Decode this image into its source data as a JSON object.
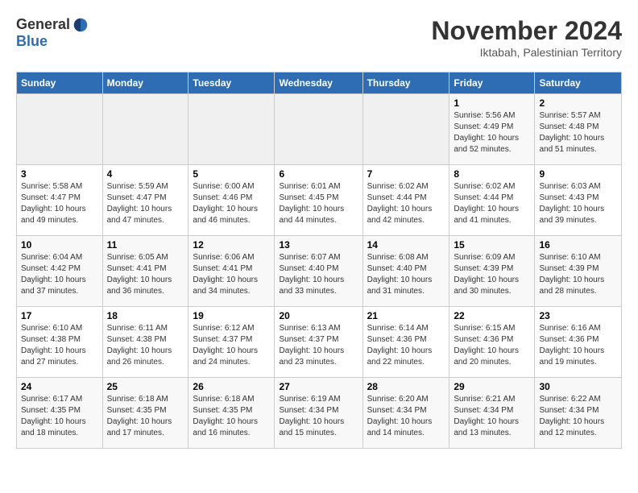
{
  "header": {
    "logo_general": "General",
    "logo_blue": "Blue",
    "month_title": "November 2024",
    "subtitle": "Iktabah, Palestinian Territory"
  },
  "days_of_week": [
    "Sunday",
    "Monday",
    "Tuesday",
    "Wednesday",
    "Thursday",
    "Friday",
    "Saturday"
  ],
  "weeks": [
    {
      "days": [
        {
          "num": "",
          "info": ""
        },
        {
          "num": "",
          "info": ""
        },
        {
          "num": "",
          "info": ""
        },
        {
          "num": "",
          "info": ""
        },
        {
          "num": "",
          "info": ""
        },
        {
          "num": "1",
          "info": "Sunrise: 5:56 AM\nSunset: 4:49 PM\nDaylight: 10 hours\nand 52 minutes."
        },
        {
          "num": "2",
          "info": "Sunrise: 5:57 AM\nSunset: 4:48 PM\nDaylight: 10 hours\nand 51 minutes."
        }
      ]
    },
    {
      "days": [
        {
          "num": "3",
          "info": "Sunrise: 5:58 AM\nSunset: 4:47 PM\nDaylight: 10 hours\nand 49 minutes."
        },
        {
          "num": "4",
          "info": "Sunrise: 5:59 AM\nSunset: 4:47 PM\nDaylight: 10 hours\nand 47 minutes."
        },
        {
          "num": "5",
          "info": "Sunrise: 6:00 AM\nSunset: 4:46 PM\nDaylight: 10 hours\nand 46 minutes."
        },
        {
          "num": "6",
          "info": "Sunrise: 6:01 AM\nSunset: 4:45 PM\nDaylight: 10 hours\nand 44 minutes."
        },
        {
          "num": "7",
          "info": "Sunrise: 6:02 AM\nSunset: 4:44 PM\nDaylight: 10 hours\nand 42 minutes."
        },
        {
          "num": "8",
          "info": "Sunrise: 6:02 AM\nSunset: 4:44 PM\nDaylight: 10 hours\nand 41 minutes."
        },
        {
          "num": "9",
          "info": "Sunrise: 6:03 AM\nSunset: 4:43 PM\nDaylight: 10 hours\nand 39 minutes."
        }
      ]
    },
    {
      "days": [
        {
          "num": "10",
          "info": "Sunrise: 6:04 AM\nSunset: 4:42 PM\nDaylight: 10 hours\nand 37 minutes."
        },
        {
          "num": "11",
          "info": "Sunrise: 6:05 AM\nSunset: 4:41 PM\nDaylight: 10 hours\nand 36 minutes."
        },
        {
          "num": "12",
          "info": "Sunrise: 6:06 AM\nSunset: 4:41 PM\nDaylight: 10 hours\nand 34 minutes."
        },
        {
          "num": "13",
          "info": "Sunrise: 6:07 AM\nSunset: 4:40 PM\nDaylight: 10 hours\nand 33 minutes."
        },
        {
          "num": "14",
          "info": "Sunrise: 6:08 AM\nSunset: 4:40 PM\nDaylight: 10 hours\nand 31 minutes."
        },
        {
          "num": "15",
          "info": "Sunrise: 6:09 AM\nSunset: 4:39 PM\nDaylight: 10 hours\nand 30 minutes."
        },
        {
          "num": "16",
          "info": "Sunrise: 6:10 AM\nSunset: 4:39 PM\nDaylight: 10 hours\nand 28 minutes."
        }
      ]
    },
    {
      "days": [
        {
          "num": "17",
          "info": "Sunrise: 6:10 AM\nSunset: 4:38 PM\nDaylight: 10 hours\nand 27 minutes."
        },
        {
          "num": "18",
          "info": "Sunrise: 6:11 AM\nSunset: 4:38 PM\nDaylight: 10 hours\nand 26 minutes."
        },
        {
          "num": "19",
          "info": "Sunrise: 6:12 AM\nSunset: 4:37 PM\nDaylight: 10 hours\nand 24 minutes."
        },
        {
          "num": "20",
          "info": "Sunrise: 6:13 AM\nSunset: 4:37 PM\nDaylight: 10 hours\nand 23 minutes."
        },
        {
          "num": "21",
          "info": "Sunrise: 6:14 AM\nSunset: 4:36 PM\nDaylight: 10 hours\nand 22 minutes."
        },
        {
          "num": "22",
          "info": "Sunrise: 6:15 AM\nSunset: 4:36 PM\nDaylight: 10 hours\nand 20 minutes."
        },
        {
          "num": "23",
          "info": "Sunrise: 6:16 AM\nSunset: 4:36 PM\nDaylight: 10 hours\nand 19 minutes."
        }
      ]
    },
    {
      "days": [
        {
          "num": "24",
          "info": "Sunrise: 6:17 AM\nSunset: 4:35 PM\nDaylight: 10 hours\nand 18 minutes."
        },
        {
          "num": "25",
          "info": "Sunrise: 6:18 AM\nSunset: 4:35 PM\nDaylight: 10 hours\nand 17 minutes."
        },
        {
          "num": "26",
          "info": "Sunrise: 6:18 AM\nSunset: 4:35 PM\nDaylight: 10 hours\nand 16 minutes."
        },
        {
          "num": "27",
          "info": "Sunrise: 6:19 AM\nSunset: 4:34 PM\nDaylight: 10 hours\nand 15 minutes."
        },
        {
          "num": "28",
          "info": "Sunrise: 6:20 AM\nSunset: 4:34 PM\nDaylight: 10 hours\nand 14 minutes."
        },
        {
          "num": "29",
          "info": "Sunrise: 6:21 AM\nSunset: 4:34 PM\nDaylight: 10 hours\nand 13 minutes."
        },
        {
          "num": "30",
          "info": "Sunrise: 6:22 AM\nSunset: 4:34 PM\nDaylight: 10 hours\nand 12 minutes."
        }
      ]
    }
  ]
}
